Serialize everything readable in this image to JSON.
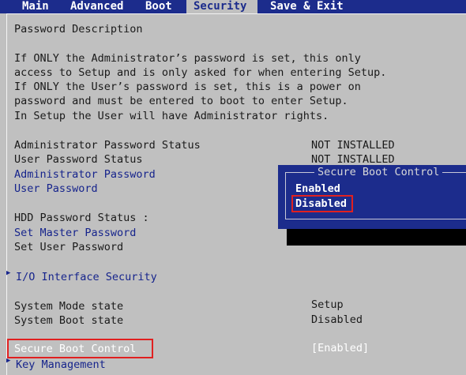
{
  "menu": {
    "tabs": [
      {
        "label": "Main"
      },
      {
        "label": "Advanced"
      },
      {
        "label": "Boot"
      },
      {
        "label": "Security"
      },
      {
        "label": "Save & Exit"
      }
    ]
  },
  "description": {
    "heading": "Password Description",
    "lines": [
      "If ONLY the Administrator’s password is set, this only",
      "access to Setup and is only asked for when entering Setup.",
      "If ONLY the User’s password is set, this is a power on",
      "password and must be entered to boot to enter Setup.",
      "In Setup the User will have Administrator rights."
    ]
  },
  "items": {
    "admin_status_label": "Administrator Password Status",
    "admin_status_value": "NOT INSTALLED",
    "user_status_label": "User Password Status",
    "user_status_value": "NOT INSTALLED",
    "admin_password": "Administrator Password",
    "user_password": "User Password",
    "hdd_status_label": "HDD Password Status  :",
    "set_master_password": "Set Master Password",
    "set_user_password": "Set User Password",
    "io_interface_security": "I/O Interface Security",
    "system_mode_label": "System Mode state",
    "system_mode_value": "Setup",
    "system_boot_label": "System Boot state",
    "system_boot_value": "Disabled",
    "secure_boot_label": "Secure Boot Control",
    "secure_boot_value": "[Enabled]",
    "key_management": "Key Management"
  },
  "popup": {
    "title": "Secure Boot Control",
    "options": [
      "Enabled",
      "Disabled"
    ],
    "selected": "Disabled"
  },
  "colors": {
    "background": "#c0c0c0",
    "menubar": "#1c2c8c",
    "link_text": "#16248c",
    "highlight": "#e02020"
  }
}
